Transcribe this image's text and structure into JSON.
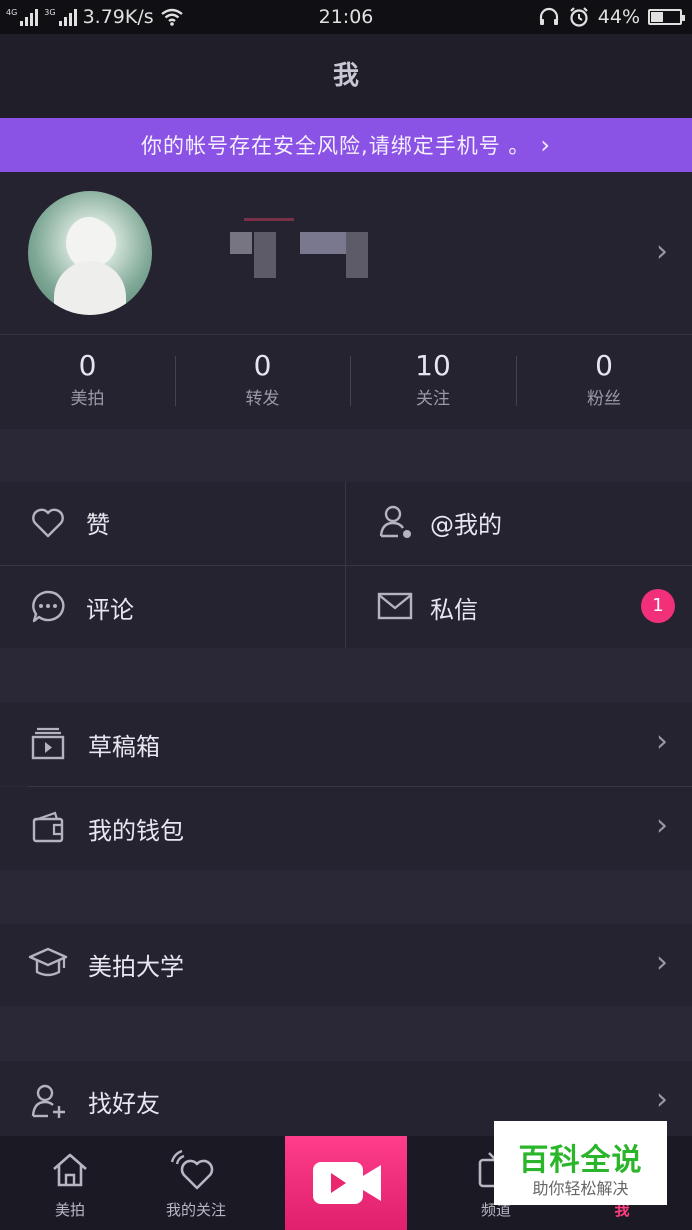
{
  "status_bar": {
    "net_left": "4G",
    "net_right": "3G",
    "speed": "3.79K/s",
    "time": "21:06",
    "battery": "44%",
    "battery_level": 0.44
  },
  "header": {
    "title": "我"
  },
  "banner": {
    "text": "你的帐号存在安全风险,请绑定手机号 。"
  },
  "stats": [
    {
      "value": "0",
      "label": "美拍"
    },
    {
      "value": "0",
      "label": "转发"
    },
    {
      "value": "10",
      "label": "关注"
    },
    {
      "value": "0",
      "label": "粉丝"
    }
  ],
  "grid": {
    "likes": "赞",
    "mentions": "@我的",
    "comments": "评论",
    "messages": "私信",
    "messages_badge": "1"
  },
  "menu": {
    "drafts": "草稿箱",
    "wallet": "我的钱包",
    "university": "美拍大学",
    "find_friends": "找好友"
  },
  "tabbar": {
    "home": "美拍",
    "following": "我的关注",
    "channels": "频道",
    "me": "我",
    "me_color": "#ff3d7f"
  },
  "watermark": {
    "title": "百科全说",
    "subtitle": "助你轻松解决"
  },
  "colors": {
    "accent": "#8b52e6",
    "badge": "#f2307a",
    "background": "#2a2836"
  }
}
